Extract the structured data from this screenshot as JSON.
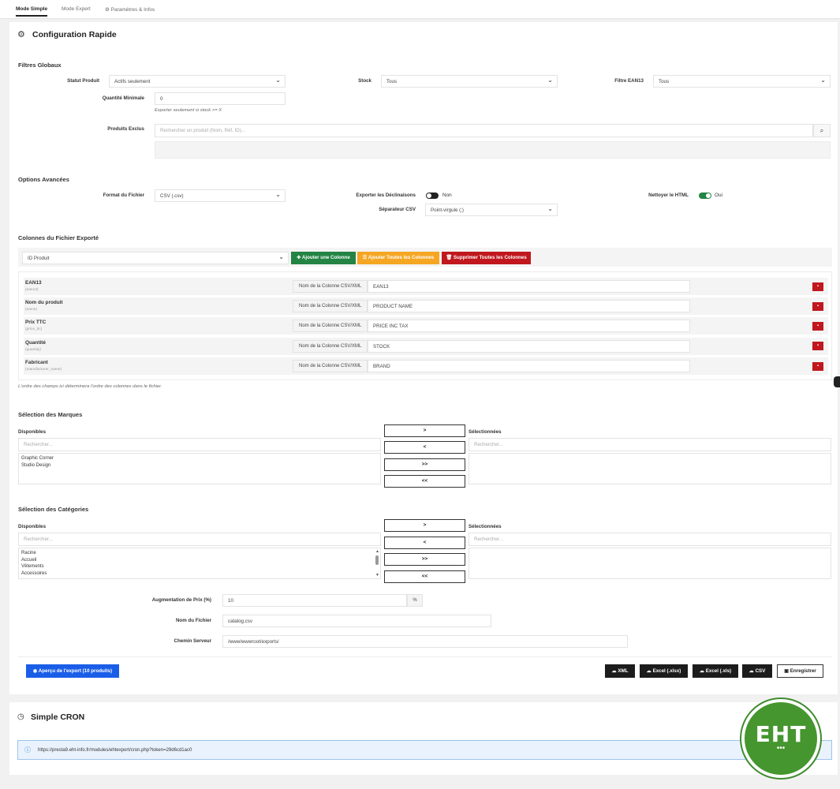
{
  "tabs": {
    "simple": "Mode Simple",
    "expert": "Mode Expert",
    "settings": "Paramètres & Infos"
  },
  "config": {
    "title": "Configuration Rapide",
    "global_filters_title": "Filtres Globaux",
    "status_label": "Statut Produit",
    "status_value": "Actifs seulement",
    "stock_label": "Stock",
    "stock_value": "Tous",
    "ean_label": "Filtre EAN13",
    "ean_value": "Tous",
    "min_qty_label": "Quantité Minimale",
    "min_qty_value": "0",
    "min_qty_help": "Exporter seulement si stock >= X",
    "excluded_label": "Produits Exclus",
    "excluded_placeholder": "Rechercher un produit (Nom, Réf, ID)...",
    "advanced_title": "Options Avancées",
    "format_label": "Format du Fichier",
    "format_value": "CSV (.csv)",
    "declinations_label": "Exporter les Déclinaisons",
    "declinations_value": "Non",
    "separator_label": "Séparateur CSV",
    "separator_value": "Point-virgule (;)",
    "clean_html_label": "Nettoyer le HTML",
    "clean_html_value": "Oui"
  },
  "columns": {
    "title": "Colonnes du Fichier Exporté",
    "select_value": "ID Produit",
    "add_button": "Ajouter une Colonne",
    "add_all_button": "Ajouter Toutes les Colonnes",
    "remove_all_button": "Supprimer Toutes les Colonnes",
    "column_label": "Nom de la Colonne CSV/XML",
    "rows": [
      {
        "name": "EAN13",
        "key": "(ean13)",
        "value": "EAN13"
      },
      {
        "name": "Nom du produit",
        "key": "(name)",
        "value": "PRODUCT NAME"
      },
      {
        "name": "Prix TTC",
        "key": "(price_ttc)",
        "value": "PRICE INC TAX"
      },
      {
        "name": "Quantité",
        "key": "(quantity)",
        "value": "STOCK"
      },
      {
        "name": "Fabricant",
        "key": "(manufacturer_name)",
        "value": "BRAND"
      }
    ],
    "help": "L'ordre des champs ici déterminera l'ordre des colonnes dans le fichier."
  },
  "brands": {
    "title": "Sélection des Marques",
    "available_label": "Disponibles",
    "selected_label": "Sélectionnées",
    "search_placeholder": "Rechercher...",
    "items": [
      "Graphic Corner",
      "Studio Design"
    ],
    "btn_add": ">",
    "btn_remove": "<",
    "btn_add_all": ">>",
    "btn_remove_all": "<<"
  },
  "categories": {
    "title": "Sélection des Catégories",
    "available_label": "Disponibles",
    "selected_label": "Sélectionnées",
    "search_placeholder": "Rechercher...",
    "items": [
      "Racine",
      "Accueil",
      "Vêtements",
      "Accessoires"
    ],
    "btn_add": ">",
    "btn_remove": "<",
    "btn_add_all": ">>",
    "btn_remove_all": "<<"
  },
  "misc": {
    "price_label": "Augmentation de Prix (%)",
    "price_value": "10",
    "price_unit": "%",
    "filename_label": "Nom du Fichier",
    "filename_value": "catalog.csv",
    "path_label": "Chemin Serveur",
    "path_value": "/www/wwwroot/exports/"
  },
  "actions": {
    "preview": "Aperçu de l'export (10 produits)",
    "xml": "XML",
    "xlsx": "Excel (.xlsx)",
    "xls": "Excel (.xls)",
    "csv": "CSV",
    "save": "Enregistrer"
  },
  "cron": {
    "title": "Simple CRON",
    "url": "https://presta9.eht-info.fr/modules/ehtexport/cron.php?token=29d6cd1ac0"
  },
  "logo": {
    "text": "EHT"
  },
  "colors": {
    "green": "#238443",
    "orange": "#f5a623",
    "red": "#c0181e",
    "blue": "#1a5ee8",
    "dark": "#1c1c1c",
    "logo_green": "#45962f"
  }
}
